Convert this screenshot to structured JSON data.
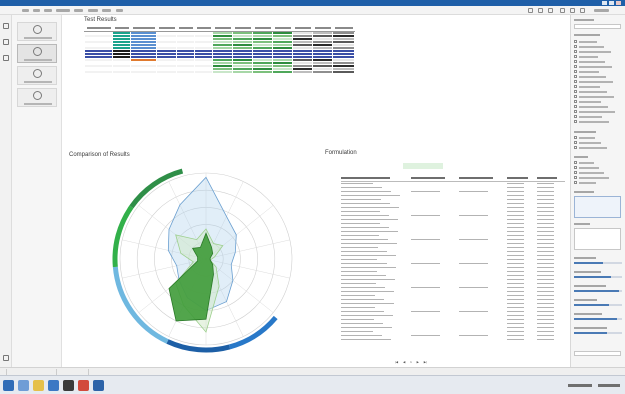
{
  "app": {
    "title": ""
  },
  "test_results": {
    "title": "Test Results",
    "rows": 14,
    "cols": 13
  },
  "chart_section": {
    "title": "Comparison of Results"
  },
  "formulation": {
    "title": "Formulation",
    "left_name": "",
    "left_subtitle": "",
    "right_name": ""
  },
  "pager": {
    "page": "1"
  },
  "bottom_tabs": [
    {
      "label": ""
    },
    {
      "label": ""
    },
    {
      "label": ""
    }
  ],
  "colors": {
    "accent": "#1f5fa8",
    "highlight_row": "#3a4ea6",
    "teal": "#1aa38c",
    "green": "#32b04a",
    "blue": "#2878c8",
    "radar_fill": "#3f9b38"
  }
}
